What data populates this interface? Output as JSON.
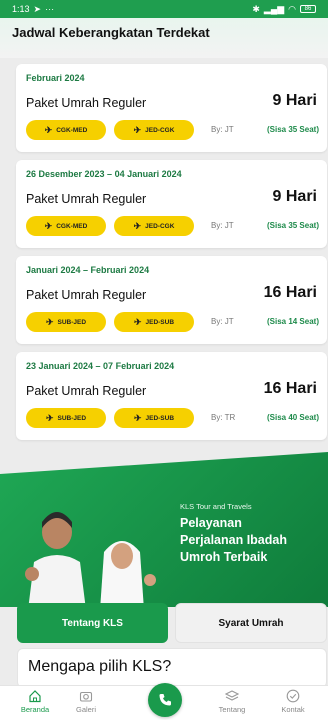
{
  "status_bar": {
    "time": "1:13",
    "extra": "···",
    "battery": "86"
  },
  "header": {
    "title": "Jadwal Keberangkatan Terdekat"
  },
  "packages": [
    {
      "date": "Februari 2024",
      "name": "Paket Umrah Reguler",
      "duration": "9 Hari",
      "route1": "CGK-MED",
      "route2": "JED-CGK",
      "by": "By: JT",
      "seats": "(Sisa 35 Seat)"
    },
    {
      "date": "26 Desember 2023 – 04 Januari 2024",
      "name": "Paket Umrah Reguler",
      "duration": "9 Hari",
      "route1": "CGK-MED",
      "route2": "JED-CGK",
      "by": "By: JT",
      "seats": "(Sisa 35 Seat)"
    },
    {
      "date": "Januari 2024 – Februari 2024",
      "name": "Paket Umrah Reguler",
      "duration": "16 Hari",
      "route1": "SUB-JED",
      "route2": "JED-SUB",
      "by": "By: JT",
      "seats": "(Sisa 14 Seat)"
    },
    {
      "date": "23 Januari 2024 – 07 Februari 2024",
      "name": "Paket Umrah Reguler",
      "duration": "16 Hari",
      "route1": "SUB-JED",
      "route2": "JED-SUB",
      "by": "By: TR",
      "seats": "(Sisa 40 Seat)"
    }
  ],
  "promo": {
    "brand": "KLS Tour and Travels",
    "line1": "Pelayanan",
    "line2": "Perjalanan Ibadah",
    "line3": "Umroh Terbaik"
  },
  "tabs": {
    "active": "Tentang KLS",
    "inactive": "Syarat Umrah"
  },
  "why": {
    "title": "Mengapa pilih KLS?"
  },
  "nav": [
    {
      "label": "Beranda",
      "icon": "home-icon"
    },
    {
      "label": "Galeri",
      "icon": "camera-icon"
    },
    {
      "label": "Tentang",
      "icon": "layers-icon"
    },
    {
      "label": "Kontak",
      "icon": "check-circle-icon"
    }
  ],
  "colors": {
    "brand_green": "#1a9a4c",
    "accent_yellow": "#f6d000",
    "seat_green": "#1d8a4a"
  }
}
